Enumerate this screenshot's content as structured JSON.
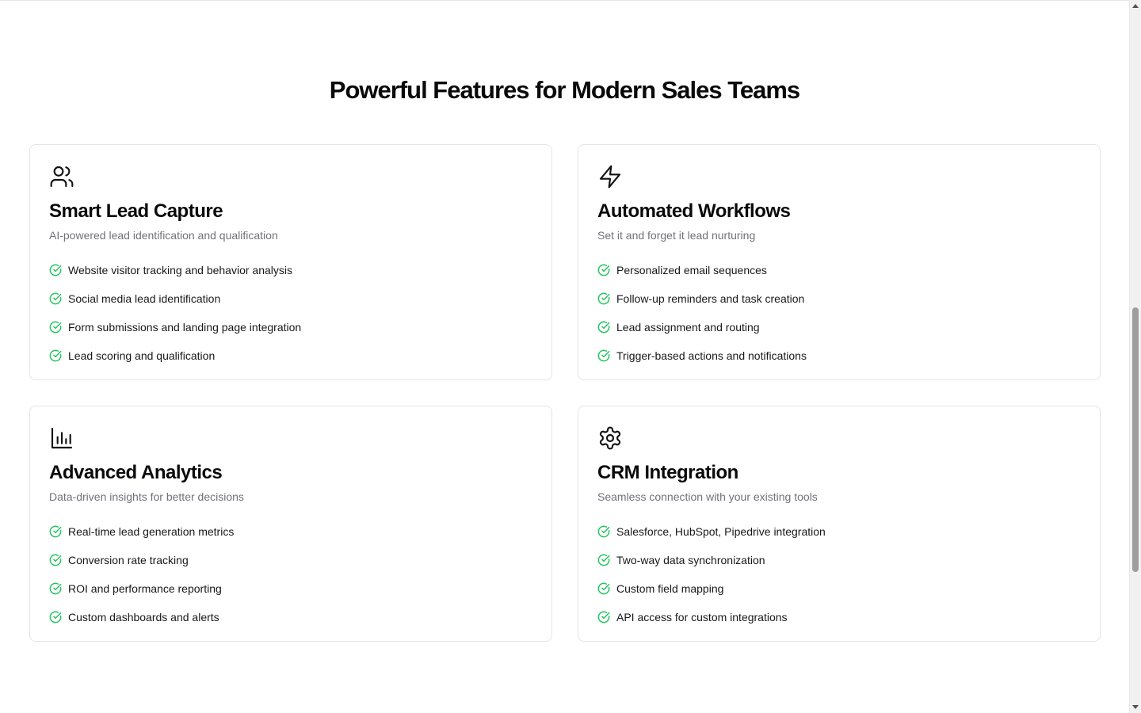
{
  "section": {
    "title": "Powerful Features for Modern Sales Teams"
  },
  "cards": [
    {
      "icon": "users-icon",
      "title": "Smart Lead Capture",
      "subtitle": "AI-powered lead identification and qualification",
      "features": [
        "Website visitor tracking and behavior analysis",
        "Social media lead identification",
        "Form submissions and landing page integration",
        "Lead scoring and qualification"
      ]
    },
    {
      "icon": "lightning-icon",
      "title": "Automated Workflows",
      "subtitle": "Set it and forget it lead nurturing",
      "features": [
        "Personalized email sequences",
        "Follow-up reminders and task creation",
        "Lead assignment and routing",
        "Trigger-based actions and notifications"
      ]
    },
    {
      "icon": "bar-chart-icon",
      "title": "Advanced Analytics",
      "subtitle": "Data-driven insights for better decisions",
      "features": [
        "Real-time lead generation metrics",
        "Conversion rate tracking",
        "ROI and performance reporting",
        "Custom dashboards and alerts"
      ]
    },
    {
      "icon": "gear-icon",
      "title": "CRM Integration",
      "subtitle": "Seamless connection with your existing tools",
      "features": [
        "Salesforce, HubSpot, Pipedrive integration",
        "Two-way data synchronization",
        "Custom field mapping",
        "API access for custom integrations"
      ]
    }
  ],
  "colors": {
    "check": "#22c55e",
    "subtitle": "#71717a",
    "border": "#e4e4e7"
  }
}
